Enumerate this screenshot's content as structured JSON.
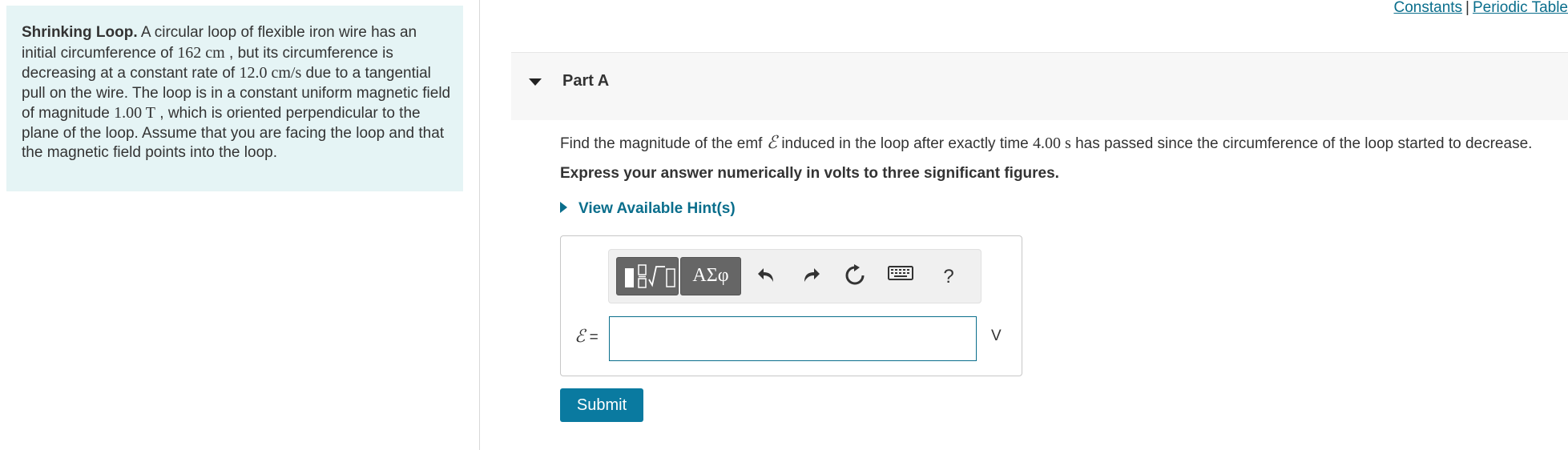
{
  "top_links": {
    "constants": "Constants",
    "separator": "|",
    "periodic_table": "Periodic Table"
  },
  "problem": {
    "title": "Shrinking Loop.",
    "text_1": " A circular loop of flexible iron wire has an initial circumference of ",
    "circumference_value": "162 cm",
    "text_2": " , but its circumference is decreasing at a constant rate of ",
    "rate_value": "12.0 cm/s",
    "text_3": " due to a tangential pull on the wire. The loop is in a constant uniform magnetic field of magnitude ",
    "field_value": "1.00 T",
    "text_4": " , which is oriented perpendicular to the plane of the loop. Assume that you are facing the loop and that the magnetic field points into the loop."
  },
  "part": {
    "label": "Part A"
  },
  "question": {
    "text_1": "Find the magnitude of the emf ",
    "emf_symbol": "ℰ",
    "text_2": " induced in the loop after exactly time ",
    "time_value": "4.00 s",
    "text_3": " has passed since the circumference of the loop started to decrease."
  },
  "instruction": "Express your answer numerically in volts to three significant figures.",
  "hints_label": "View Available Hint(s)",
  "toolbar": {
    "templates_icon": "templates-icon",
    "symbols_label": "ΑΣφ",
    "undo_icon": "undo-icon",
    "redo_icon": "redo-icon",
    "reset_icon": "reset-icon",
    "keyboard_icon": "keyboard-icon",
    "help_label": "?"
  },
  "answer": {
    "label_symbol": "ℰ",
    "label_eq": " =",
    "value": "",
    "unit": "V"
  },
  "submit_label": "Submit",
  "colors": {
    "accent": "#0a6e8c",
    "problem_bg": "#e5f4f5",
    "submit_bg": "#0a7aa0",
    "toolbar_dark": "#666666"
  }
}
